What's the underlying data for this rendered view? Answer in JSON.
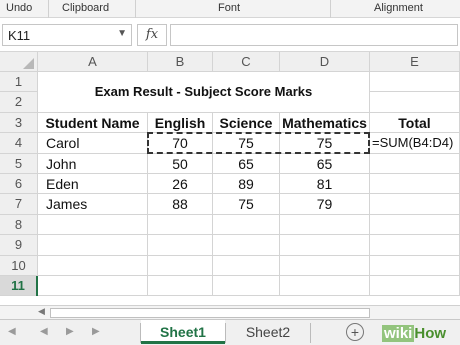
{
  "ribbon": {
    "undo": "Undo",
    "clipboard": "Clipboard",
    "font": "Font",
    "alignment": "Alignment"
  },
  "formula_bar": {
    "name_box": "K11",
    "fx": "fx",
    "formula": ""
  },
  "columns": [
    "A",
    "B",
    "C",
    "D",
    "E"
  ],
  "rows": [
    "1",
    "2",
    "3",
    "4",
    "5",
    "6",
    "7",
    "8",
    "9",
    "10",
    "11"
  ],
  "selected_row": "11",
  "title": "Exam Result - Subject Score Marks",
  "headers": [
    "Student Name",
    "English",
    "Science",
    "Mathematics",
    "Total"
  ],
  "students": [
    {
      "name": "Carol",
      "english": "70",
      "science": "75",
      "math": "75",
      "total": "=SUM(B4:D4)"
    },
    {
      "name": "John",
      "english": "50",
      "science": "65",
      "math": "65",
      "total": ""
    },
    {
      "name": "Eden",
      "english": "26",
      "science": "89",
      "math": "81",
      "total": ""
    },
    {
      "name": "James",
      "english": "88",
      "science": "75",
      "math": "79",
      "total": ""
    }
  ],
  "sheets": {
    "active": "Sheet1",
    "other": "Sheet2"
  },
  "watermark": {
    "wiki": "wiki",
    "how": "How"
  },
  "colors": {
    "accent": "#217346",
    "grid": "#d4d4d4",
    "header_bg": "#efefef"
  }
}
